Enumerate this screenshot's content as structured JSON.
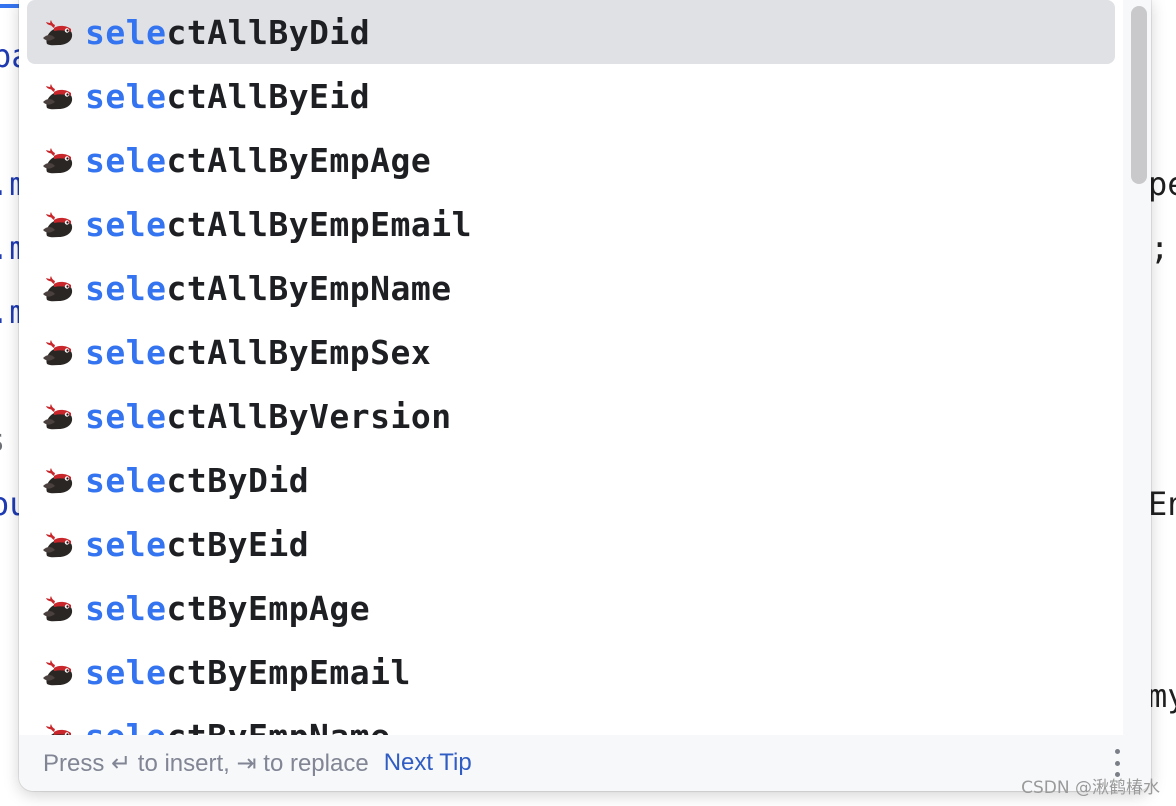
{
  "editor_background": {
    "left_fragments": [
      {
        "text": "pa",
        "tone": "blue"
      },
      {
        "text": ".m",
        "tone": "blue"
      },
      {
        "text": ".m",
        "tone": "blue"
      },
      {
        "text": ".m",
        "tone": "blue"
      },
      {
        "text": "s u",
        "tone": "gray"
      },
      {
        "text": "ou",
        "tone": "blue"
      }
    ],
    "right_fragments": [
      "pe",
      ";",
      "En",
      "my"
    ]
  },
  "completion_popup": {
    "typed_prefix": "sele",
    "icon": "mybatis-mapper-method-icon",
    "selected_index": 0,
    "items": [
      {
        "match": "sele",
        "rest": "ctAllByDid"
      },
      {
        "match": "sele",
        "rest": "ctAllByEid"
      },
      {
        "match": "sele",
        "rest": "ctAllByEmpAge"
      },
      {
        "match": "sele",
        "rest": "ctAllByEmpEmail"
      },
      {
        "match": "sele",
        "rest": "ctAllByEmpName"
      },
      {
        "match": "sele",
        "rest": "ctAllByEmpSex"
      },
      {
        "match": "sele",
        "rest": "ctAllByVersion"
      },
      {
        "match": "sele",
        "rest": "ctByDid"
      },
      {
        "match": "sele",
        "rest": "ctByEid"
      },
      {
        "match": "sele",
        "rest": "ctByEmpAge"
      },
      {
        "match": "sele",
        "rest": "ctByEmpEmail"
      },
      {
        "match": "sele",
        "rest": "ctByEmpName"
      }
    ],
    "footer": {
      "hint": "Press ↵ to insert, ⇥ to replace",
      "next_tip": "Next Tip",
      "more_icon": "more-vertical-icon"
    }
  },
  "colors": {
    "match_highlight": "#3574f0",
    "item_text": "#1e1f22",
    "selected_bg": "#dfe1e5",
    "link": "#2f5dc4"
  },
  "watermark": "CSDN @湫鹤椿水"
}
